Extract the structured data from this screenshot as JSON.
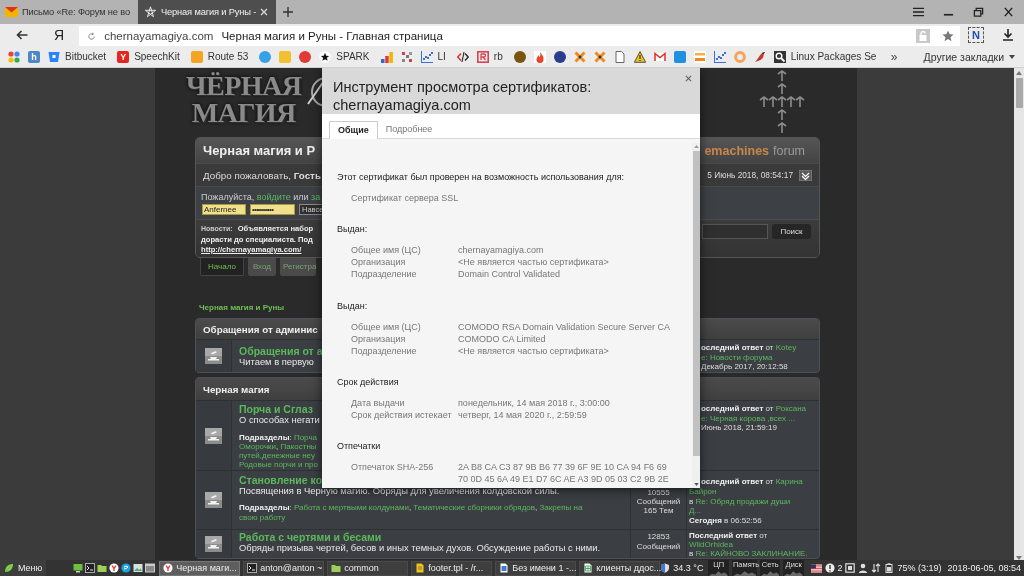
{
  "browser": {
    "tabs": [
      {
        "title": "Письмо «Re: Форум не во",
        "selected": false,
        "kind": "mail"
      },
      {
        "title": "Черная магия и Руны -",
        "selected": true,
        "kind": "site"
      }
    ],
    "logo_button": "Я",
    "address": {
      "domain": "chernayamagiya.com",
      "page_title": "Черная магия и Руны - Главная страница"
    },
    "extension_badge": "N",
    "bookmarks": [
      {
        "kind": "apps"
      },
      {
        "kind": "tile",
        "color": "#4f86c6",
        "glyph": "h"
      },
      {
        "kind": "bucket",
        "color": "#2684ff",
        "label": "Bitbucket"
      },
      {
        "kind": "tile",
        "color": "#e52620",
        "glyph": "Y",
        "label": "SpeechKit"
      },
      {
        "kind": "tile",
        "color": "#f4a423",
        "label": "Route 53"
      },
      {
        "kind": "circle",
        "color": "#37a1e6"
      },
      {
        "kind": "tile",
        "color": "#f0c030"
      },
      {
        "kind": "circle",
        "color": "#e23b36"
      },
      {
        "kind": "star",
        "label": "SPARK"
      },
      {
        "kind": "bars"
      },
      {
        "kind": "grid"
      },
      {
        "kind": "chart",
        "color": "#3b6fd8",
        "label": "LI"
      },
      {
        "kind": "code"
      },
      {
        "kind": "frame",
        "color": "#d64550",
        "label": "rb"
      },
      {
        "kind": "circle",
        "color": "#7a5510"
      },
      {
        "kind": "flame"
      },
      {
        "kind": "circle",
        "color": "#2b3d8f"
      },
      {
        "kind": "cross",
        "color": "#f08a1c"
      },
      {
        "kind": "cross",
        "color": "#f08a1c"
      },
      {
        "kind": "file"
      },
      {
        "kind": "triangle"
      },
      {
        "kind": "mail"
      },
      {
        "kind": "tile",
        "color": "#1f8fe0"
      },
      {
        "kind": "stripes"
      },
      {
        "kind": "chart",
        "color": "#3b6fd8"
      },
      {
        "kind": "ring",
        "color": "#f7a35c"
      },
      {
        "kind": "bird"
      },
      {
        "kind": "search",
        "label": "Linux Packages Se"
      }
    ],
    "more_bookmarks": "»",
    "other_bookmarks": "Другие закладки"
  },
  "site": {
    "logo": [
      "ЧЁРНАЯ",
      "МАГИЯ"
    ],
    "header": {
      "title": "Черная магия и Р",
      "brand": [
        "emachines",
        "forum"
      ],
      "welcome": "Добро пожаловать, **Гость**",
      "date": "5 Июнь 2018, 08:54:17",
      "login_prompt": [
        {
          "kind": "plain",
          "text": "Пожалуйста, "
        },
        {
          "kind": "link",
          "text": "войдите"
        },
        {
          "kind": "plain",
          "text": " или "
        },
        {
          "kind": "link",
          "text": "за"
        }
      ],
      "username": "Anfernee",
      "password": "•••••••••••",
      "duration": "Навсе",
      "news_label": "Новости:",
      "news_lines": [
        "Объявляется набор",
        "дорасти до специалиста. Под"
      ],
      "news_link": "http://chernayamagiya.com/",
      "search_button": "Поиск"
    },
    "nav": [
      {
        "label": "Начало",
        "selected": true
      },
      {
        "label": "Вход",
        "selected": false
      },
      {
        "label": "Регистра",
        "selected": false
      }
    ],
    "breadcrumb": "Черная магия и Руны",
    "categories": [
      {
        "title": "Обращения от админис",
        "boards": [
          {
            "title": "Обращения от а",
            "description": "Читаем в первую",
            "last_post": [
              [
                {
                  "kind": "bold",
                  "text": "оследний ответ"
                },
                {
                  "kind": "plain",
                  "text": " от "
                },
                {
                  "kind": "link",
                  "text": "Kotey"
                }
              ],
              [
                {
                  "kind": "link",
                  "text": "e: Новости форума"
                }
              ],
              [
                {
                  "kind": "plain",
                  "text": "Декабрь 2017, 20:12:58"
                }
              ]
            ]
          }
        ]
      },
      {
        "title": "Черная магия",
        "boards": [
          {
            "title": "Порча и Сглаз",
            "description": "О способах негати",
            "subboards": [
              [
                {
                  "kind": "bold",
                  "text": "Подразделы"
                },
                {
                  "kind": "plain",
                  "text": ": "
                },
                {
                  "kind": "link",
                  "text": "Порча"
                }
              ],
              [
                {
                  "kind": "link",
                  "text": "Оморочки"
                },
                {
                  "kind": "plain",
                  "text": ", "
                },
                {
                  "kind": "link",
                  "text": "Пакостны"
                }
              ],
              [
                {
                  "kind": "link",
                  "text": "путей,денежные неу"
                }
              ],
              [
                {
                  "kind": "link",
                  "text": "Родовые порчи и про"
                }
              ]
            ],
            "last_post": [
              [
                {
                  "kind": "bold",
                  "text": "оследний ответ"
                },
                {
                  "kind": "plain",
                  "text": " от "
                },
                {
                  "kind": "link",
                  "text": "Роксана"
                }
              ],
              [
                {
                  "kind": "link",
                  "text": "e: Черная корова ,всех ..."
                }
              ],
              [
                {
                  "kind": "plain",
                  "text": "Июнь 2018, 21:59:19"
                }
              ]
            ]
          },
          {
            "title": "Становление ко",
            "description": "Посвящения в Черную магию. Обряды для увеличения колдовской силы.",
            "subboards": [
              [
                {
                  "kind": "bold",
                  "text": "Подразделы"
                },
                {
                  "kind": "plain",
                  "text": ": "
                },
                {
                  "kind": "link",
                  "text": "Работа с мертвыми колдунами"
                },
                {
                  "kind": "plain",
                  "text": ", "
                },
                {
                  "kind": "link",
                  "text": "Тематические сборники обрядов"
                },
                {
                  "kind": "plain",
                  "text": ", "
                },
                {
                  "kind": "link",
                  "text": "Закрепы на"
                }
              ],
              [
                {
                  "kind": "link",
                  "text": "свою работу"
                }
              ]
            ],
            "stats": [
              "10555",
              "Сообщений",
              "165 Тем"
            ],
            "last_post": [
              [
                {
                  "kind": "bold",
                  "text": "оследний ответ"
                },
                {
                  "kind": "plain",
                  "text": " от "
                },
                {
                  "kind": "link",
                  "text": "Карина"
                }
              ],
              [
                {
                  "kind": "link",
                  "text": "Байрон"
                }
              ],
              [
                {
                  "kind": "plain",
                  "text": "в "
                },
                {
                  "kind": "link",
                  "text": "Re: Обряд продажи души"
                }
              ],
              [
                {
                  "kind": "link",
                  "text": "Д..."
                }
              ],
              [
                {
                  "kind": "bold",
                  "text": "Сегодня"
                },
                {
                  "kind": "plain",
                  "text": " в 06:52:56"
                }
              ]
            ]
          },
          {
            "title": "Работа с чертями и бесами",
            "description": "Обряды призыва чертей, бесов и иных темных духов. Обсуждение работы с ними.",
            "stats": [
              "12853",
              "Сообщений"
            ],
            "last_post": [
              [
                {
                  "kind": "bold",
                  "text": "Последний ответ"
                },
                {
                  "kind": "plain",
                  "text": " от"
                }
              ],
              [
                {
                  "kind": "link",
                  "text": "WildOrhidea"
                }
              ],
              [
                {
                  "kind": "plain",
                  "text": "в "
                },
                {
                  "kind": "link",
                  "text": "Re: КАЙНОВО ЗАКЛИНАНИЕ."
                }
              ]
            ]
          }
        ]
      }
    ]
  },
  "certificate_dialog": {
    "title": "Инструмент просмотра сертификатов: chernayamagiya.com",
    "tabs": [
      {
        "label": "Общие",
        "selected": true
      },
      {
        "label": "Подробнее",
        "selected": false
      }
    ],
    "intro": "Этот сертификат был проверен на возможность использования для:",
    "usages": [
      "Сертификат сервера SSL"
    ],
    "sections": [
      {
        "heading": "Выдан:",
        "rows": [
          {
            "label": "Общее имя (ЦС)",
            "values": [
              "chernayamagiya.com"
            ]
          },
          {
            "label": "Организация",
            "values": [
              "<Не является частью сертификата>"
            ]
          },
          {
            "label": "Подразделение",
            "values": [
              "Domain Control Validated"
            ]
          }
        ]
      },
      {
        "heading": "Выдан:",
        "rows": [
          {
            "label": "Общее имя (ЦС)",
            "values": [
              "COMODO RSA Domain Validation Secure Server CA"
            ]
          },
          {
            "label": "Организация",
            "values": [
              "COMODO CA Limited"
            ]
          },
          {
            "label": "Подразделение",
            "values": [
              "<Не является частью сертификата>"
            ]
          }
        ]
      },
      {
        "heading": "Срок действия",
        "rows": [
          {
            "label": "Дата выдачи",
            "values": [
              "понедельник, 14 мая 2018 г., 3:00:00"
            ]
          },
          {
            "label": "Срок действия истекает",
            "values": [
              "четверг, 14 мая 2020 г., 2:59:59"
            ]
          }
        ]
      },
      {
        "heading": "Отпечатки",
        "rows": [
          {
            "label": "Отпечаток SHA-256",
            "values": [
              "2A B8 CA C3 87 9B B6 77 39 6F 9E 10 CA 94 F6 69",
              "70 0D 45 6A 49 E1 D7 6C AE A3 9D 05 03 C2 9B 2E"
            ]
          }
        ]
      }
    ]
  },
  "taskbar": {
    "menu_label": "Меню",
    "launchers": [
      {
        "kind": "monitor"
      },
      {
        "kind": "terminal"
      },
      {
        "kind": "folder"
      },
      {
        "kind": "browser"
      },
      {
        "kind": "chat"
      },
      {
        "kind": "picture"
      },
      {
        "kind": "window"
      }
    ],
    "tasks": [
      {
        "label": "Черная маги...",
        "selected": true,
        "kind": "browser"
      },
      {
        "label": "anton@anton ~",
        "selected": false,
        "kind": "terminal"
      },
      {
        "label": "common",
        "selected": false,
        "kind": "folder"
      },
      {
        "label": "footer.tpl - /r...",
        "selected": false,
        "kind": "editor"
      },
      {
        "label": "Без имени 1 -...",
        "selected": false,
        "kind": "writer"
      },
      {
        "label": "клиенты ддос...",
        "selected": false,
        "kind": "sheet"
      }
    ],
    "temperature": "34.3 °C",
    "monitors": [
      "ЦП",
      "Память",
      "Сеть",
      "Диск"
    ],
    "alert_count": "2",
    "battery": "75% (3:19)",
    "clock": "2018-06-05, 08:54"
  }
}
